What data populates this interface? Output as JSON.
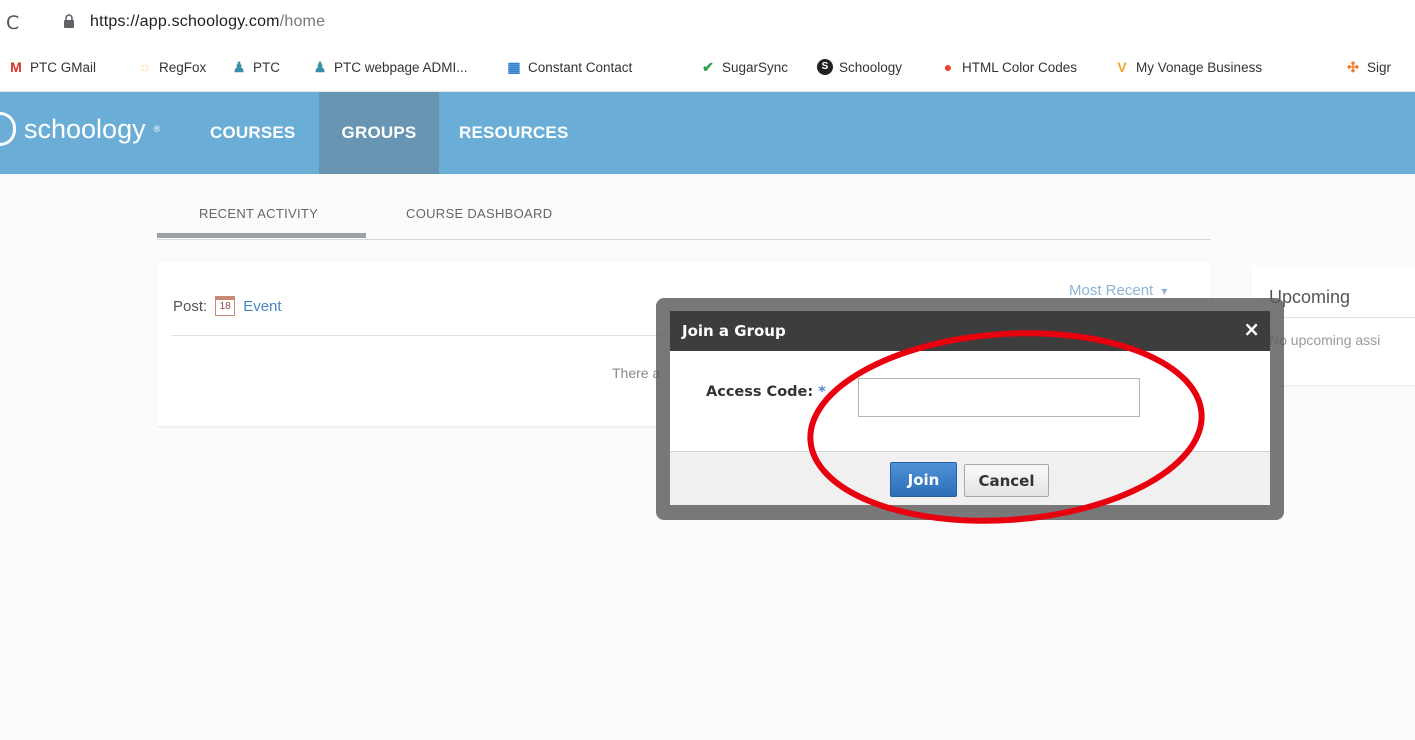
{
  "browser": {
    "reload_glyph": "C",
    "url_host": "https://app.schoology.com",
    "url_path": "/home",
    "bookmarks": [
      {
        "label": "PTC GMail",
        "icon": "gmail-icon",
        "glyph": "M",
        "color": "#d93025"
      },
      {
        "label": "RegFox",
        "icon": "regfox-icon",
        "glyph": "◌",
        "color": "#f2b233"
      },
      {
        "label": "PTC",
        "icon": "ptc-icon",
        "glyph": "♟",
        "color": "#3a8fa8"
      },
      {
        "label": "PTC webpage ADMI...",
        "icon": "ptc-icon",
        "glyph": "♟",
        "color": "#3a8fa8"
      },
      {
        "label": "Constant Contact",
        "icon": "constant-contact-icon",
        "glyph": "▦",
        "color": "#2f7fd0"
      },
      {
        "label": "SugarSync",
        "icon": "sugarsync-icon",
        "glyph": "✔",
        "color": "#2f9e4a"
      },
      {
        "label": "Schoology",
        "icon": "schoology-icon",
        "glyph": "S",
        "color": "#222222"
      },
      {
        "label": "HTML Color Codes",
        "icon": "html-color-codes-icon",
        "glyph": "●",
        "color": "#e8412c"
      },
      {
        "label": "My Vonage Business",
        "icon": "vonage-icon",
        "glyph": "V",
        "color": "#f0a830"
      },
      {
        "label": "Sigr",
        "icon": "hubspot-icon",
        "glyph": "✣",
        "color": "#f57c22"
      }
    ]
  },
  "header": {
    "logo_text": "schoology",
    "logo_mark": "®",
    "nav": [
      {
        "label": "COURSES",
        "active": false
      },
      {
        "label": "GROUPS",
        "active": true
      },
      {
        "label": "RESOURCES",
        "active": false
      }
    ],
    "bg_color": "#6aaed8"
  },
  "tabs": [
    {
      "label": "RECENT ACTIVITY",
      "active": true
    },
    {
      "label": "COURSE DASHBOARD",
      "active": false
    }
  ],
  "feed": {
    "post_label": "Post:",
    "calendar_day": "18",
    "event_label": "Event",
    "sort_label": "Most Recent",
    "sort_arrow": "▾",
    "empty_text": "There a"
  },
  "upcoming": {
    "title": "Upcoming",
    "empty_text": "No upcoming assi"
  },
  "modal": {
    "title": "Join a Group",
    "close_glyph": "×",
    "access_code_label": "Access Code:",
    "required_mark": "*",
    "access_code_value": "",
    "join_label": "Join",
    "cancel_label": "Cancel"
  },
  "annotation": {
    "color": "#e8000f"
  }
}
